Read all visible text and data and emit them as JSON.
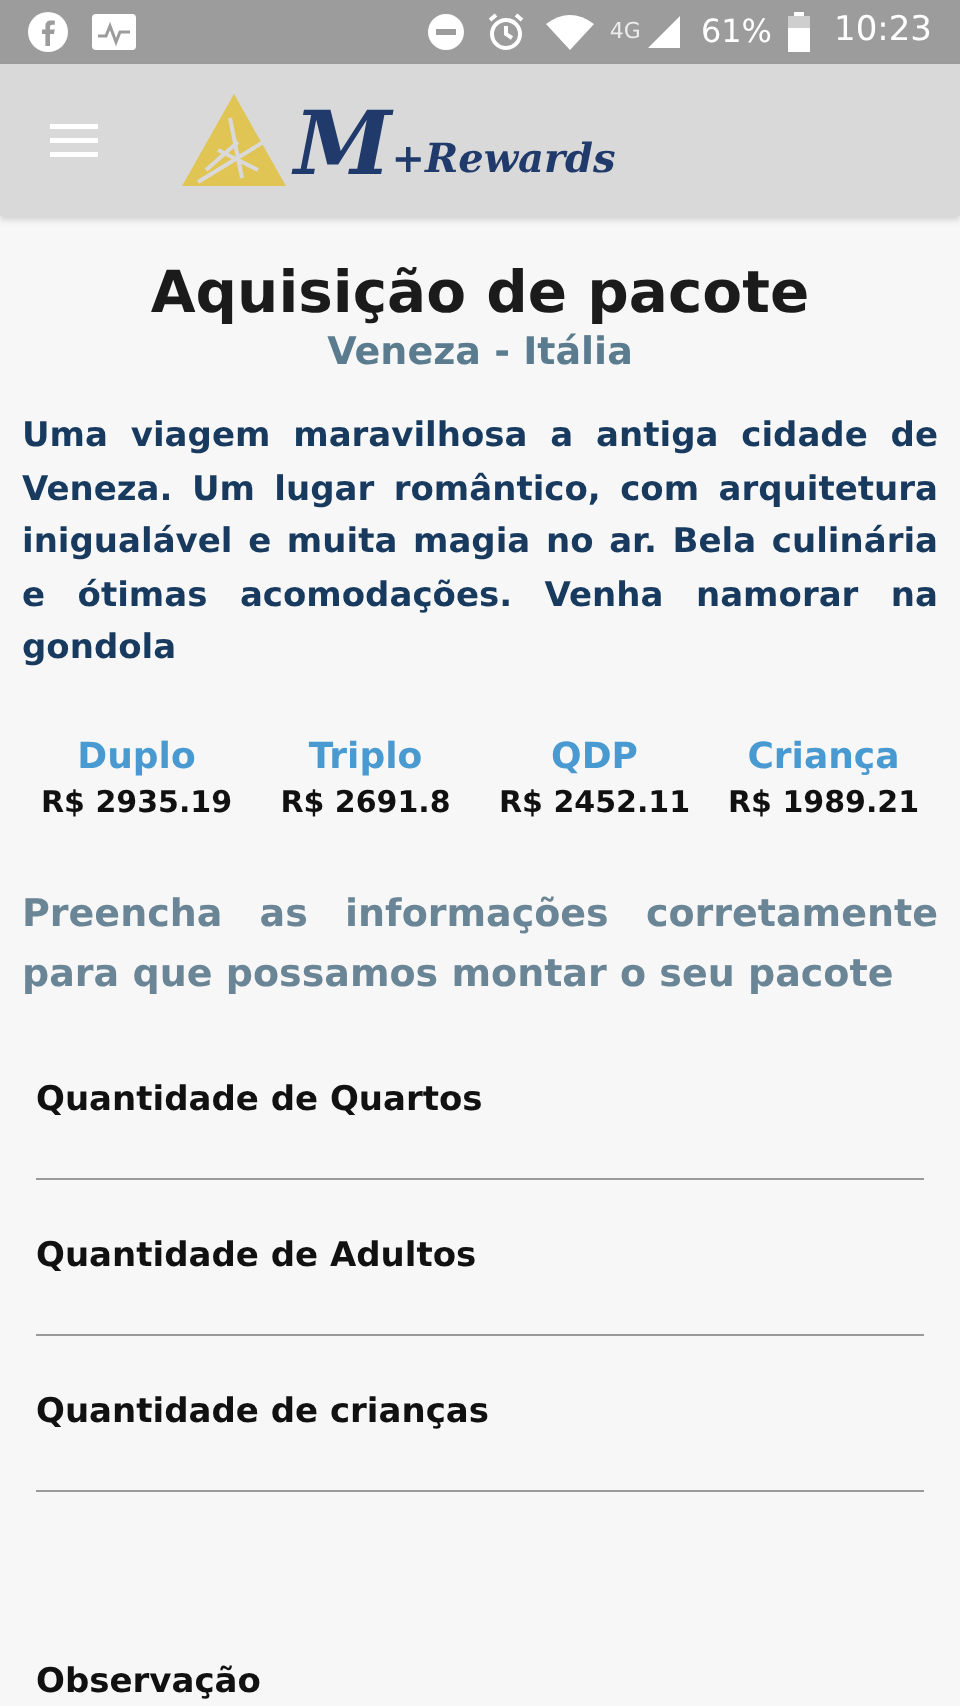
{
  "status_bar": {
    "network": "4G",
    "battery": "61%",
    "time": "10:23"
  },
  "header": {
    "logo": {
      "mark": "M",
      "text": "+Rewards"
    }
  },
  "title": "Aquisição de pacote",
  "subtitle": "Veneza - Itália",
  "description": "Uma viagem maravilhosa a antiga cidade de Veneza. Um lugar romântico, com arquitetura inigualável e muita magia no ar. Bela culinária e ótimas acomodações. Venha namorar na gondola",
  "prices": [
    {
      "label": "Duplo",
      "value": "R$ 2935.19"
    },
    {
      "label": "Triplo",
      "value": "R$ 2691.8"
    },
    {
      "label": "QDP",
      "value": "R$ 2452.11"
    },
    {
      "label": "Criança",
      "value": "R$ 1989.21"
    }
  ],
  "instructions": "Preencha as informações corretamente para que possamos montar o seu pacote",
  "fields": [
    {
      "placeholder": "Quantidade de Quartos"
    },
    {
      "placeholder": "Quantidade de Adultos"
    },
    {
      "placeholder": "Quantidade de crianças"
    },
    {
      "placeholder": "Observação"
    }
  ]
}
